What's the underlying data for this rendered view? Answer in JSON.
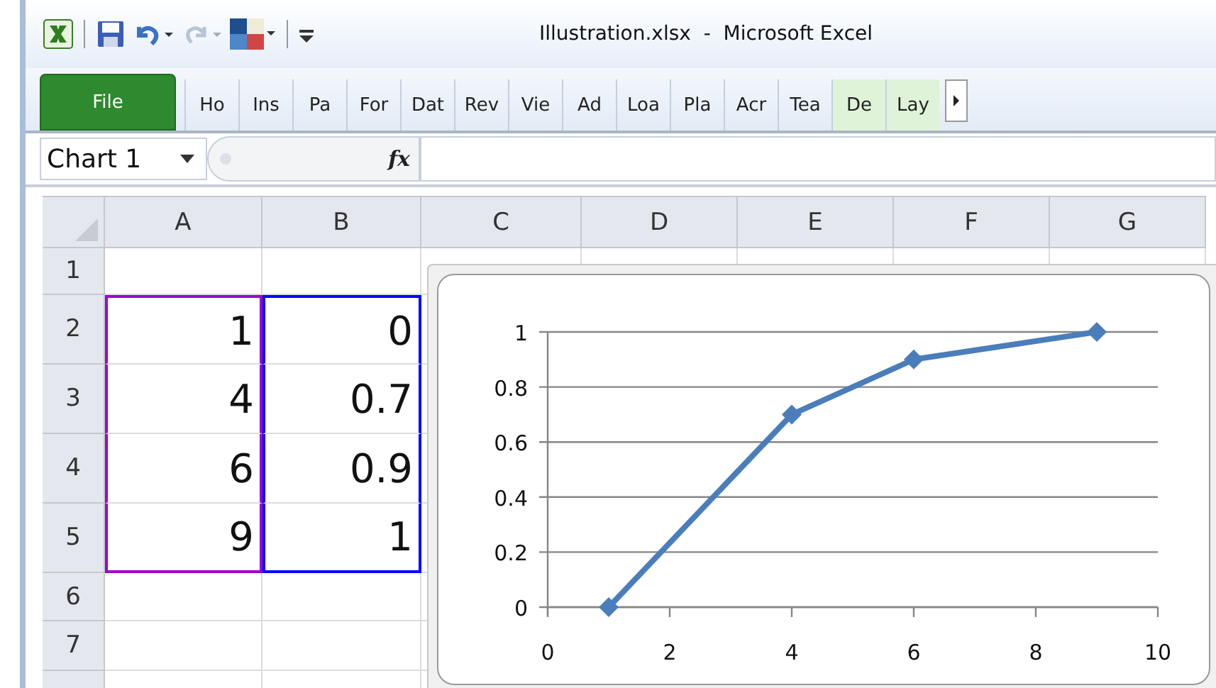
{
  "window": {
    "title": "Illustration.xlsx  -  Microsoft Excel"
  },
  "ribbon": {
    "tabs": [
      {
        "label": "File",
        "kind": "file",
        "selected": true
      },
      {
        "label": "Ho",
        "kind": "normal",
        "selected": false
      },
      {
        "label": "Ins",
        "kind": "normal",
        "selected": false
      },
      {
        "label": "Pa",
        "kind": "normal",
        "selected": false
      },
      {
        "label": "For",
        "kind": "normal",
        "selected": false
      },
      {
        "label": "Dat",
        "kind": "normal",
        "selected": false
      },
      {
        "label": "Rev",
        "kind": "normal",
        "selected": false
      },
      {
        "label": "Vie",
        "kind": "normal",
        "selected": false
      },
      {
        "label": "Ad",
        "kind": "normal",
        "selected": false
      },
      {
        "label": "Loa",
        "kind": "normal",
        "selected": false
      },
      {
        "label": "Pla",
        "kind": "normal",
        "selected": false
      },
      {
        "label": "Acr",
        "kind": "normal",
        "selected": false
      },
      {
        "label": "Tea",
        "kind": "normal",
        "selected": false
      },
      {
        "label": "De",
        "kind": "contextual",
        "selected": false
      },
      {
        "label": "Lay",
        "kind": "contextual",
        "selected": false
      }
    ]
  },
  "formula_bar": {
    "name_box": "Chart 1",
    "function_label": "fx"
  },
  "sheet": {
    "columns": [
      {
        "label": "A",
        "color": "#a000d0"
      },
      {
        "label": "B",
        "color": "#0000ff"
      },
      {
        "label": "C"
      },
      {
        "label": "D"
      },
      {
        "label": "E"
      },
      {
        "label": "F"
      },
      {
        "label": "G"
      }
    ],
    "rows": [
      {
        "label": "1",
        "cells": [
          {
            "in_range": false
          },
          {
            "in_range": false
          }
        ]
      },
      {
        "label": "2",
        "cells": [
          {
            "value": "1",
            "in_range": true
          },
          {
            "value": "0",
            "in_range": true
          }
        ]
      },
      {
        "label": "3",
        "cells": [
          {
            "value": "4",
            "in_range": true
          },
          {
            "value": "0.7",
            "in_range": true
          }
        ]
      },
      {
        "label": "4",
        "cells": [
          {
            "value": "6",
            "in_range": true
          },
          {
            "value": "0.9",
            "in_range": true
          }
        ]
      },
      {
        "label": "5",
        "cells": [
          {
            "value": "9",
            "in_range": true
          },
          {
            "value": "1",
            "in_range": true
          }
        ]
      },
      {
        "label": "6",
        "cells": [
          {
            "in_range": false
          },
          {
            "in_range": false
          }
        ]
      },
      {
        "label": "7",
        "cells": [
          {
            "in_range": false
          },
          {
            "in_range": false
          }
        ]
      }
    ]
  },
  "chart": {
    "chart_data": {
      "type": "line",
      "x": [
        1,
        4,
        6,
        9
      ],
      "series": [
        {
          "color": "#4a7ebb",
          "marker": "diamond",
          "values": [
            0,
            0.7,
            0.9,
            1
          ]
        }
      ],
      "grid": true,
      "xlim": [
        0,
        10
      ],
      "ylim": [
        0,
        1
      ],
      "xticks": [
        0,
        2,
        4,
        6,
        8,
        10
      ],
      "yticks": [
        0,
        0.2,
        0.4,
        0.6,
        0.8,
        1
      ]
    }
  }
}
